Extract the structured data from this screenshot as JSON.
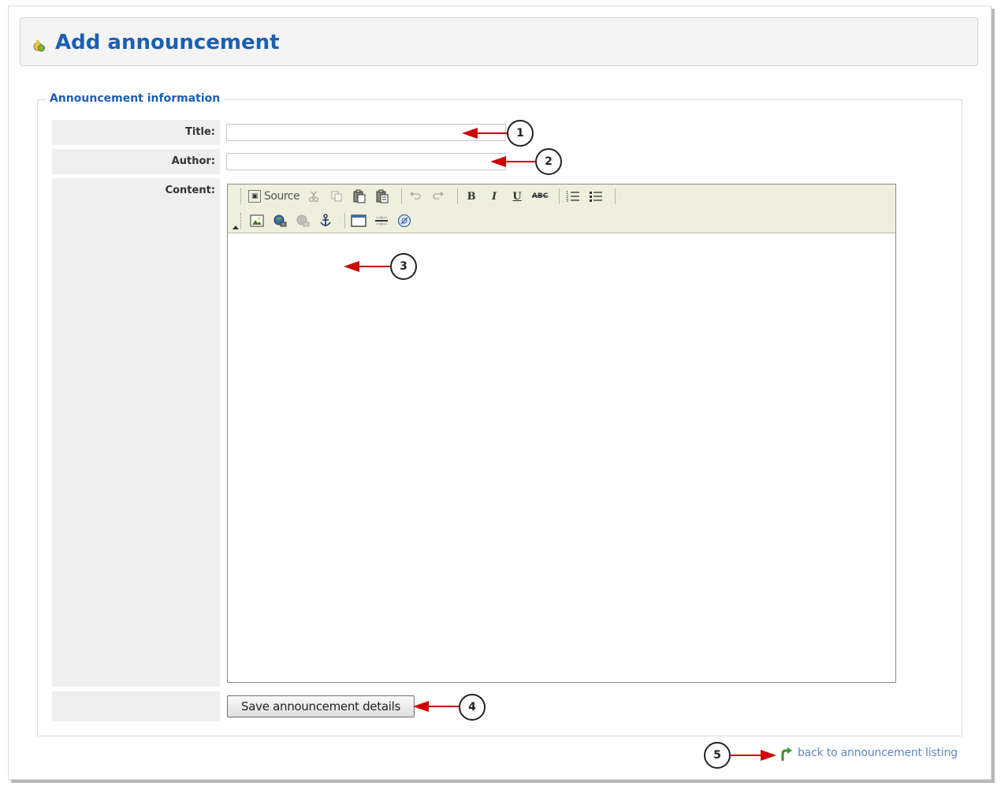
{
  "page": {
    "title": "Add announcement",
    "header_icon": "announcement-icon"
  },
  "form": {
    "legend": "Announcement information",
    "title_label": "Title:",
    "title_value": "",
    "author_label": "Author:",
    "author_value": "",
    "content_label": "Content:",
    "content_value": "",
    "save_label": "Save announcement details"
  },
  "editor": {
    "toolbar_row1": [
      {
        "name": "source",
        "label": "Source",
        "icon": "source-icon"
      },
      {
        "name": "cut",
        "icon": "cut-icon"
      },
      {
        "name": "copy",
        "icon": "copy-icon"
      },
      {
        "name": "paste",
        "icon": "paste-icon"
      },
      {
        "name": "paste-text",
        "icon": "paste-text-icon"
      },
      {
        "name": "undo",
        "icon": "undo-icon"
      },
      {
        "name": "redo",
        "icon": "redo-icon"
      },
      {
        "name": "bold",
        "label": "B",
        "icon": "bold-icon"
      },
      {
        "name": "italic",
        "label": "I",
        "icon": "italic-icon"
      },
      {
        "name": "underline",
        "label": "U",
        "icon": "underline-icon"
      },
      {
        "name": "strike",
        "label": "ABC",
        "icon": "strikethrough-icon"
      },
      {
        "name": "ordered-list",
        "icon": "ordered-list-icon"
      },
      {
        "name": "unordered-list",
        "icon": "unordered-list-icon"
      }
    ],
    "toolbar_row2": [
      {
        "name": "image",
        "icon": "image-icon"
      },
      {
        "name": "link",
        "icon": "link-icon"
      },
      {
        "name": "unlink",
        "icon": "unlink-icon"
      },
      {
        "name": "anchor",
        "icon": "anchor-icon"
      },
      {
        "name": "table",
        "icon": "table-icon"
      },
      {
        "name": "horizontal-rule",
        "icon": "horizontal-rule-icon"
      },
      {
        "name": "special-char",
        "icon": "special-char-icon"
      }
    ]
  },
  "footer": {
    "back_link": "back to announcement listing",
    "back_icon": "back-arrow-icon"
  },
  "callouts": {
    "c1": "1",
    "c2": "2",
    "c3": "3",
    "c4": "4",
    "c5": "5"
  },
  "colors": {
    "title": "#1a5fb4",
    "link": "#5b87c4",
    "callout_arrow": "#cc0000",
    "toolbar_bg": "#efefde"
  }
}
